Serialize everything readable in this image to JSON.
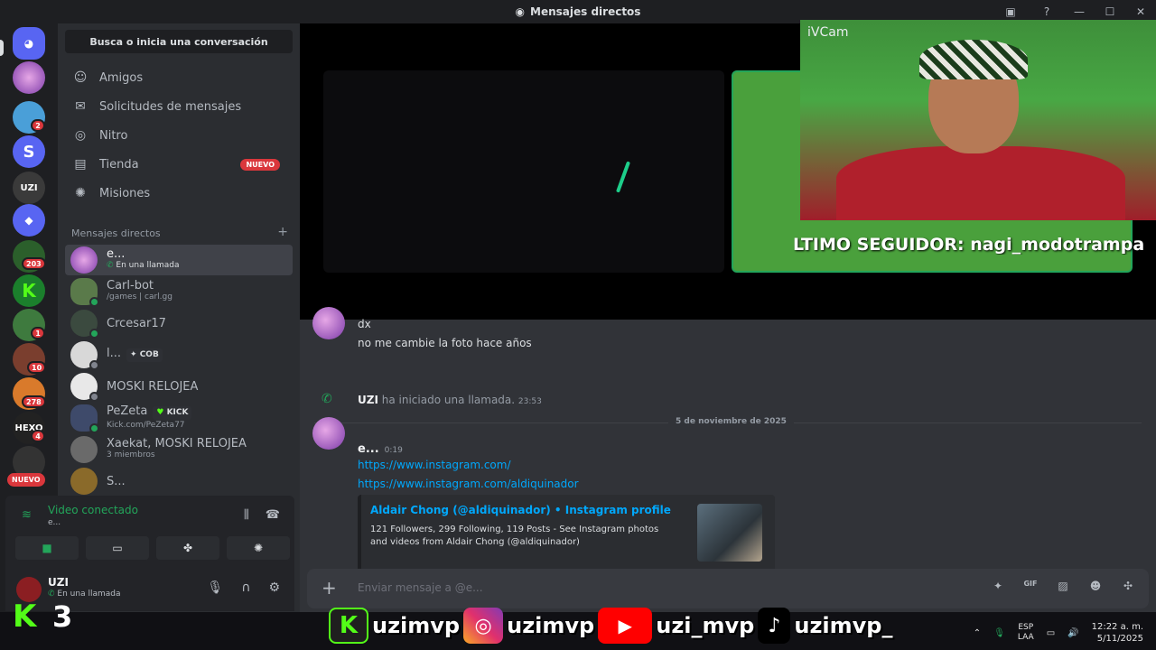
{
  "window": {
    "title": "Mensajes directos",
    "controls": [
      "—",
      "☐",
      "✕"
    ]
  },
  "sidebar": {
    "search_label": "Busca o inicia una conversación",
    "nav": [
      {
        "label": "Amigos",
        "icon": "person-wave-icon"
      },
      {
        "label": "Solicitudes de mensajes",
        "icon": "envelope-icon"
      },
      {
        "label": "Nitro",
        "icon": "nitro-icon"
      },
      {
        "label": "Tienda",
        "icon": "shop-icon",
        "badge": "NUEVO"
      },
      {
        "label": "Misiones",
        "icon": "compass-icon"
      }
    ],
    "dm_header": "Mensajes directos",
    "dm_add": "+",
    "dms": [
      {
        "name": "e...",
        "sub": "En una llamada"
      },
      {
        "name": "Carl-bot",
        "sub": "/games | carl.gg"
      },
      {
        "name": "Crcesar17",
        "sub": ""
      },
      {
        "name": "l...",
        "tag": "COB",
        "sub": ""
      },
      {
        "name": "MOSKI RELOJEA",
        "sub": ""
      },
      {
        "name": "PeZeta",
        "tag": "KICK",
        "sub": "Kick.com/PeZeta77"
      },
      {
        "name": "Xaekat, MOSKI RELOJEA",
        "sub": "3 miembros"
      },
      {
        "name": "S...",
        "sub": ""
      }
    ]
  },
  "servers": {
    "badges": [
      "2",
      "203",
      "1",
      "10",
      "278",
      "4"
    ],
    "nuevo": "NUEVO",
    "letters": {
      "s": "S"
    }
  },
  "voice": {
    "title": "Video conectado",
    "sub": "e..."
  },
  "user": {
    "name": "UZI",
    "status": "En una llamada"
  },
  "call": {
    "cam_label": "iVCam",
    "ticker": "LTIMO SEGUIDOR: nagi_modotrampa"
  },
  "messages": {
    "line1": "dx",
    "line2": "no me cambie la foto hace años",
    "system_user": "UZI",
    "system_text": "ha iniciado una llamada.",
    "system_time": "23:53",
    "date_divider": "5 de noviembre de 2025",
    "author": "e...",
    "author_time": "0:19",
    "link1": "https://www.instagram.com/",
    "link2": "https://www.instagram.com/aldiquinador",
    "embed_title": "Aldair Chong (@aldiquinador) • Instagram profile",
    "embed_desc": "121 Followers, 299 Following, 119 Posts - See Instagram photos and videos from Aldair Chong (@aldiquinador)"
  },
  "composer": {
    "placeholder": "Enviar mensaje a @e...",
    "gif": "GIF"
  },
  "overlay": {
    "kick_letter": "K",
    "kick_count": "3",
    "handles": [
      "uzimvp",
      "uzimvp",
      "uzi_mvp",
      "uzimvp_"
    ]
  },
  "tray": {
    "lang1": "ESP",
    "lang2": "LAA",
    "time": "12:22 a. m.",
    "date": "5/11/2025"
  },
  "colors": {
    "accent_green": "#23a55a",
    "danger_red": "#da373c",
    "link_blue": "#00a8fc",
    "blurple": "#5865f2"
  }
}
